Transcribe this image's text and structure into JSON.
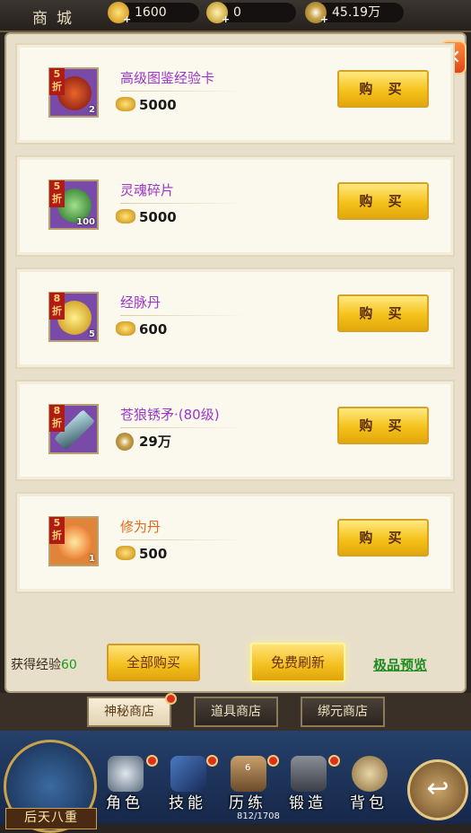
{
  "header": {
    "title": "商城",
    "currencies": [
      {
        "icon": "gold-ingot-icon",
        "value": "1600"
      },
      {
        "icon": "locked-ingot-icon",
        "value": "0"
      },
      {
        "icon": "copper-coin-icon",
        "value": "45.19万"
      }
    ]
  },
  "items": [
    {
      "name": "高级图鉴经验卡",
      "discount": "5折",
      "qty": "2",
      "price": "5000",
      "price_icon": "gold-ingot-icon",
      "buy": "购 买",
      "art_color": "#b23a1a"
    },
    {
      "name": "灵魂碎片",
      "discount": "5折",
      "qty": "100",
      "price": "5000",
      "price_icon": "gold-ingot-icon",
      "buy": "购 买",
      "art_color": "#3f9b3a"
    },
    {
      "name": "经脉丹",
      "discount": "8折",
      "qty": "5",
      "price": "600",
      "price_icon": "gold-ingot-icon",
      "buy": "购 买",
      "art_color": "#d89a10"
    },
    {
      "name": "苍狼锈矛·(80级)",
      "discount": "8折",
      "qty": "",
      "price": "29万",
      "price_icon": "copper-coin-icon",
      "buy": "购 买",
      "art_color": "#6aa0a8"
    },
    {
      "name": "修为丹",
      "discount": "5折",
      "qty": "1",
      "price": "500",
      "price_icon": "gold-ingot-icon",
      "buy": "购 买",
      "art_color": "#e87a1a"
    }
  ],
  "actions": {
    "exp_label": "获得经验",
    "exp_value": "60",
    "buy_all": "全部购买",
    "free_refresh": "免费刷新",
    "preview": "极品预览"
  },
  "tabs": [
    "神秘商店",
    "道具商店",
    "绑元商店"
  ],
  "nav": {
    "realm": "后天八重",
    "buttons": [
      "角色",
      "技能",
      "历练",
      "锻造",
      "背包"
    ],
    "exp_progress": "812/1708",
    "skill_badge": "6"
  }
}
